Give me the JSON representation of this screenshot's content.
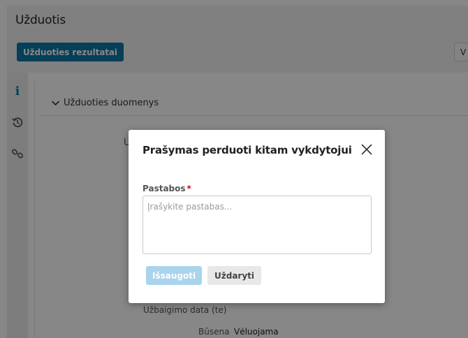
{
  "page": {
    "title": "Užduotis"
  },
  "toolbar": {
    "results_button": "Užduoties rezultatai",
    "right_button_partial": "V"
  },
  "sidebar": {
    "icons": [
      "info-icon",
      "history-icon",
      "link-icon"
    ],
    "info_glyph": "i"
  },
  "section": {
    "label": "Užduoties duomenys",
    "chevron": "chevron-down-icon"
  },
  "background": {
    "partial_letter": "U",
    "due_date_label": "Užbaigimo data (te)",
    "status_label": "Būsena",
    "status_value": "Vėluojama"
  },
  "modal": {
    "title": "Prašymas perduoti kitam vykdytojui",
    "field_label": "Pastabos",
    "required_mark": "*",
    "placeholder": "Įrašykite pastabas...",
    "value": "",
    "save_button": "Išsaugoti",
    "close_button": "Uždaryti"
  },
  "colors": {
    "primary": "#0a77a7",
    "primary_disabled": "#a9d4ec",
    "required": "#d0021b",
    "overlay": "rgba(0,0,0,0.47)"
  }
}
